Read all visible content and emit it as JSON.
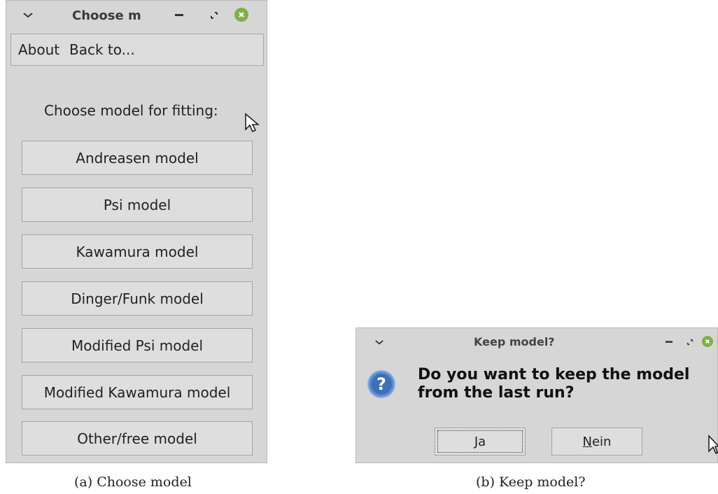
{
  "window_a": {
    "title": "Choose m",
    "menu": {
      "about": "About",
      "back": "Back to..."
    },
    "prompt": "Choose model for fitting:",
    "buttons": [
      "Andreasen model",
      "Psi model",
      "Kawamura model",
      "Dinger/Funk model",
      "Modified Psi model",
      "Modified Kawamura model",
      "Other/free model"
    ]
  },
  "window_b": {
    "title": "Keep model?",
    "question": "Do you want to keep the model from the last run?",
    "yes_rest": "a",
    "yes_mnemonic": "J",
    "no_mnemonic": "N",
    "no_rest": "ein"
  },
  "captions": {
    "a": "(a) Choose model",
    "b": "(b) Keep model?"
  },
  "icons": {
    "menu": "chevron-down-icon",
    "minimize": "minimize-icon",
    "maximize": "maximize-icon",
    "close": "close-icon",
    "question": "question-icon",
    "cursor": "mouse-pointer-icon"
  },
  "colors": {
    "window_bg": "#d6d6d6",
    "close_button": "#7fb04a",
    "question_icon": "#3f6fb5"
  }
}
